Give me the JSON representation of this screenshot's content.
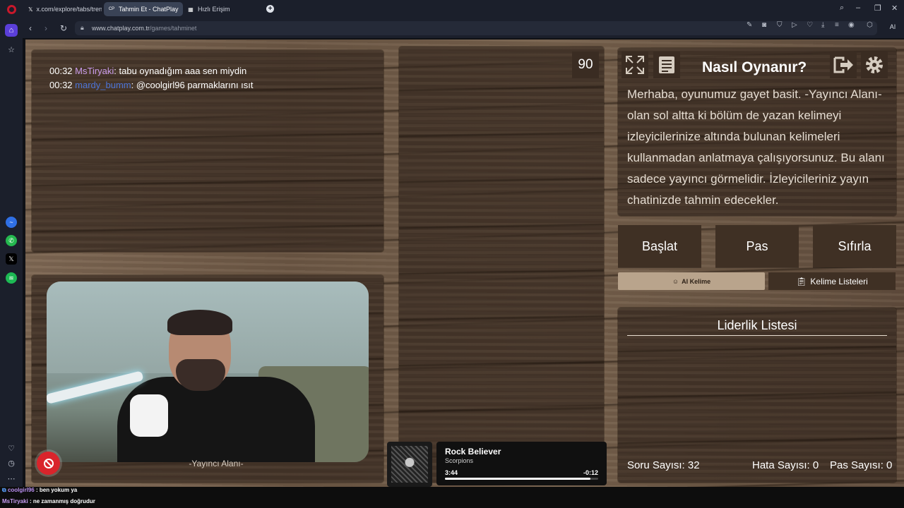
{
  "browser": {
    "tabs": [
      {
        "label": "x.com/explore/tabs/trend",
        "icon": "x-icon"
      },
      {
        "label": "Tahmin Et - ChatPlay",
        "icon": "chatplay-icon"
      },
      {
        "label": "Hızlı Erişim",
        "icon": "grid-icon"
      }
    ],
    "url_host": "www.chatplay.com.tr",
    "url_path": "/games/tahminet",
    "ai_label": "AI"
  },
  "chat": {
    "messages": [
      {
        "time": "00:32",
        "user": "MsTiryaki",
        "text": ": tabu oynadığım aaa sen miydin"
      },
      {
        "time": "00:32",
        "user": "mardy_bumm",
        "text": ": @coolgirl96 parmaklarını ısıt"
      }
    ]
  },
  "timer": "90",
  "howto": {
    "title": "Nasıl Oynanır?",
    "text": "Merhaba, oyunumuz gayet basit. -Yayıncı Alanı- olan sol altta ki bölüm de yazan kelimeyi izleyicilerinize altında bulunan kelimeleri kullanmadan anlatmaya çalışıyorsunuz. Bu alanı sadece yayıncı görmelidir. İzleyicileriniz yayın chatinizde tahmin edecekler."
  },
  "actions": {
    "start": "Başlat",
    "pass": "Pas",
    "reset": "Sıfırla"
  },
  "tabs": {
    "ai_word": "AI Kelime",
    "word_lists": "Kelime Listeleri"
  },
  "leaderboard": {
    "title": "Liderlik Listesi"
  },
  "stats": {
    "questions_label": "Soru Sayısı:",
    "questions_value": "32",
    "errors_label": "Hata Sayısı:",
    "errors_value": "0",
    "passes_label": "Pas Sayısı:",
    "passes_value": "0"
  },
  "streamer_area": {
    "caption": "-Yayıncı Alanı-"
  },
  "music": {
    "title": "Rock Believer",
    "artist": "Scorpions",
    "elapsed": "3:44",
    "remaining": "-0:12",
    "progress": 0.95
  },
  "bottom_chat": [
    {
      "user": "coolgirl96",
      "text": " : ben yokum ya"
    },
    {
      "user": "MsTiryaki",
      "text": " : ne zamanmış doğrudur"
    }
  ],
  "colors": {
    "accent": "#5b3fd9",
    "wood_panel": "#3a2c22",
    "user_purple": "#c89be9",
    "user_blue": "#4c73d6"
  }
}
